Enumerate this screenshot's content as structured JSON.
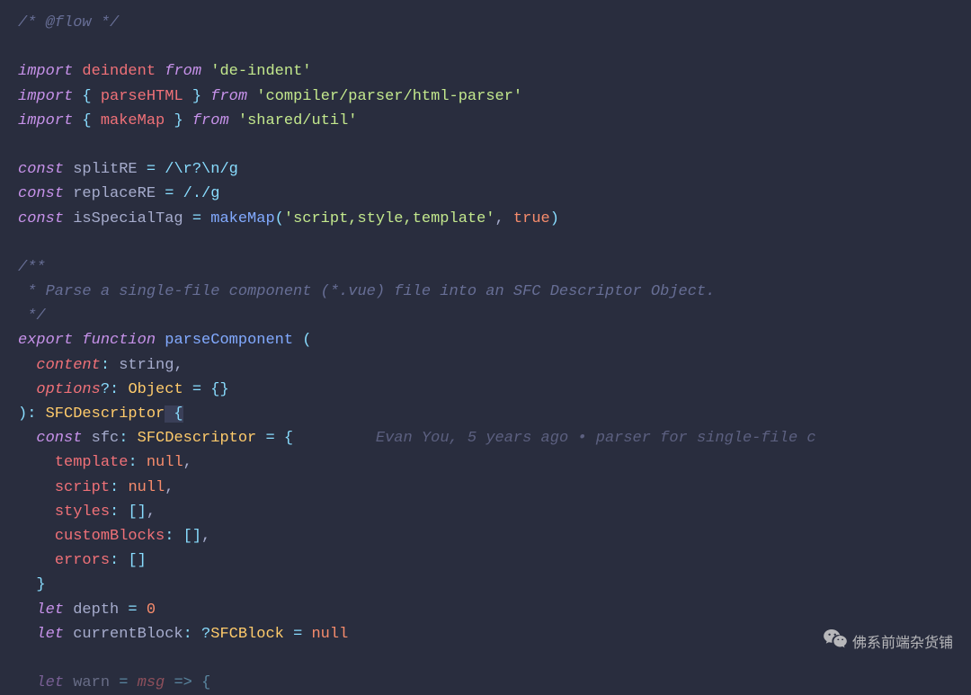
{
  "code": {
    "l1_comment": "/* @flow */",
    "l3_import": "import",
    "l3_name": "deindent",
    "l3_from": "from",
    "l3_str": "'de-indent'",
    "l4_import": "import",
    "l4_brace_open": "{ ",
    "l4_name": "parseHTML",
    "l4_brace_close": " }",
    "l4_from": "from",
    "l4_str": "'compiler/parser/html-parser'",
    "l5_import": "import",
    "l5_brace_open": "{ ",
    "l5_name": "makeMap",
    "l5_brace_close": " }",
    "l5_from": "from",
    "l5_str": "'shared/util'",
    "l7_const": "const",
    "l7_var": "splitRE",
    "l7_eq": "=",
    "l7_regex": "/\\r?\\n/g",
    "l8_const": "const",
    "l8_var": "replaceRE",
    "l8_eq": "=",
    "l8_regex": "/./g",
    "l9_const": "const",
    "l9_var": "isSpecialTag",
    "l9_eq": "=",
    "l9_func": "makeMap",
    "l9_paren_open": "(",
    "l9_str": "'script,style,template'",
    "l9_comma": ", ",
    "l9_bool": "true",
    "l9_paren_close": ")",
    "l11_comment_open": "/**",
    "l12_comment": " * Parse a single-file component (*.vue) file into an SFC Descriptor Object.",
    "l13_comment_close": " */",
    "l14_export": "export",
    "l14_function": "function",
    "l14_funcname": "parseComponent",
    "l14_paren": " (",
    "l15_param": "content",
    "l15_colon": ": ",
    "l15_type": "string",
    "l15_comma": ",",
    "l16_param": "options",
    "l16_question": "?",
    "l16_colon": ": ",
    "l16_type": "Object",
    "l16_eq": " = ",
    "l16_braces": "{}",
    "l17_paren_close": ")",
    "l17_colon": ": ",
    "l17_type": "SFCDescriptor",
    "l17_brace": " {",
    "l18_const": "const",
    "l18_var": "sfc",
    "l18_colon": ": ",
    "l18_type": "SFCDescriptor",
    "l18_eq": " = ",
    "l18_brace": "{",
    "l18_blame": "Evan You, 5 years ago • parser for single-file c",
    "l19_prop": "template",
    "l19_colon": ": ",
    "l19_val": "null",
    "l19_comma": ",",
    "l20_prop": "script",
    "l20_colon": ": ",
    "l20_val": "null",
    "l20_comma": ",",
    "l21_prop": "styles",
    "l21_colon": ": ",
    "l21_val": "[]",
    "l21_comma": ",",
    "l22_prop": "customBlocks",
    "l22_colon": ": ",
    "l22_val": "[]",
    "l22_comma": ",",
    "l23_prop": "errors",
    "l23_colon": ": ",
    "l23_val": "[]",
    "l24_brace": "}",
    "l25_let": "let",
    "l25_var": "depth",
    "l25_eq": " = ",
    "l25_val": "0",
    "l26_let": "let",
    "l26_var": "currentBlock",
    "l26_colon": ": ",
    "l26_question": "?",
    "l26_type": "SFCBlock",
    "l26_eq": " = ",
    "l26_val": "null",
    "l28_let": "let",
    "l28_var": "warn",
    "l28_eq": " = ",
    "l28_param": "msg",
    "l28_arrow": " => ",
    "l28_brace": "{"
  },
  "watermark": {
    "text": "佛系前端杂货铺"
  }
}
